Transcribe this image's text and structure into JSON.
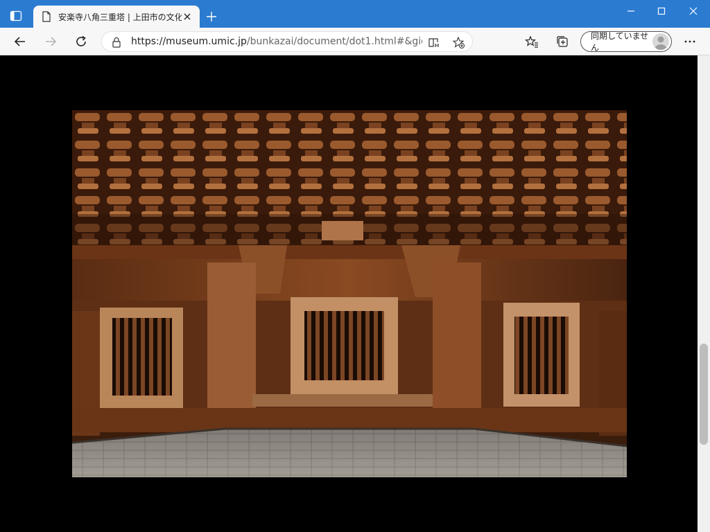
{
  "browser": {
    "tab_title": "安楽寺八角三重塔 | 上田市の文化",
    "url_host": "https://museum.umic.jp",
    "url_path": "/bunkazai/document/dot1.html#&gid=0...",
    "profile_label": "同期していません"
  },
  "icons": {
    "window_menu": "tab-actions-icon",
    "tab": "page-icon",
    "close_tab": "close-icon",
    "new_tab": "plus-icon",
    "back": "arrow-left-icon",
    "forward": "arrow-right-icon",
    "refresh": "refresh-icon",
    "lock": "lock-icon",
    "reader": "immersive-reader-icon",
    "add_favorite": "star-add-icon",
    "favorites": "favorites-icon",
    "collections": "collections-icon",
    "profile": "avatar-icon",
    "more": "more-icon"
  },
  "colors": {
    "titlebar": "#2b7bd1",
    "toolbar": "#f7f7f7",
    "page_background": "#000000"
  }
}
